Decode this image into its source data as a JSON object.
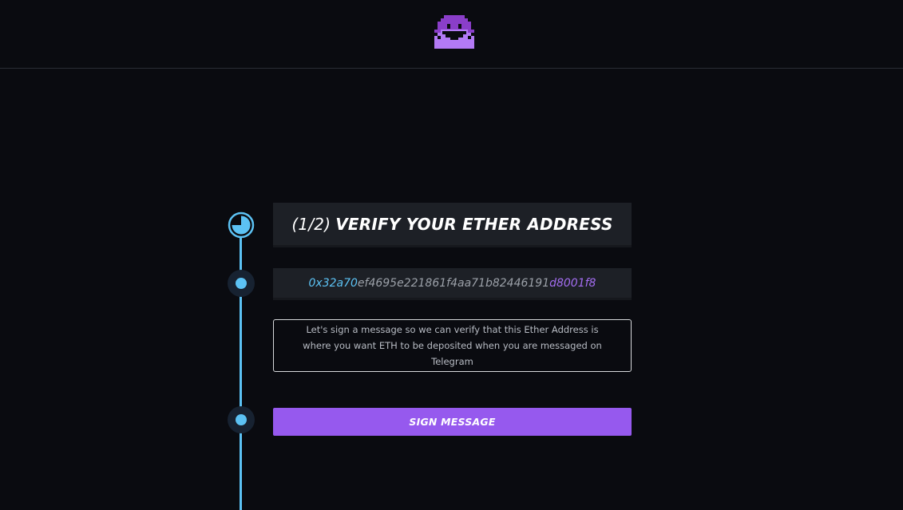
{
  "colors": {
    "background": "#0a0b10",
    "accent_blue": "#5cc2f4",
    "accent_purple": "#9659ee",
    "panel": "#1d2026"
  },
  "header": {
    "logo_icon": "pixel-envelope-face-icon"
  },
  "title": {
    "step": "(1/2)",
    "text": "VERIFY YOUR ETHER ADDRESS"
  },
  "address": {
    "start": "0x32a70",
    "middle": "ef4695e221861f4aa71b82446191",
    "end": "d8001f8"
  },
  "message": {
    "text": "Let's sign a message so we can verify that this Ether Address is where you want ETH to be deposited when you are messaged on Telegram"
  },
  "button": {
    "label": "SIGN MESSAGE"
  },
  "timeline": {
    "progress_icon": "progress-pie-icon",
    "step_dot_icon": "step-dot-icon"
  }
}
